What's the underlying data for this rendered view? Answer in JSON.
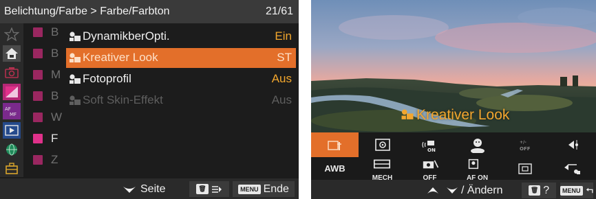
{
  "menu": {
    "header": {
      "title": "Belichtung/Farbe > Farbe/Farbton",
      "page": "21/61"
    },
    "category_icons": [
      "star-icon",
      "camera-home-icon",
      "photo-icon",
      "exposure-color-icon",
      "af-mf-icon",
      "playback-icon",
      "network-icon",
      "toolbox-icon"
    ],
    "subtabs": [
      {
        "letter": "B"
      },
      {
        "letter": "B"
      },
      {
        "letter": "M"
      },
      {
        "letter": "B"
      },
      {
        "letter": "W"
      },
      {
        "letter": "F"
      },
      {
        "letter": "Z"
      }
    ],
    "items": [
      {
        "label": "DynamikberOpti.",
        "value": "Ein"
      },
      {
        "label": "Kreativer Look",
        "value": "ST"
      },
      {
        "label": "Fotoprofil",
        "value": "Aus"
      },
      {
        "label": "Soft Skin-Effekt",
        "value": "Aus"
      }
    ],
    "footer": {
      "page_label": "Seite",
      "delete_key": "🗑",
      "menu_key": "MENU",
      "end_label": "Ende"
    }
  },
  "liveview": {
    "overlay_label": "Kreativer Look",
    "fn_row1": [
      "creative-look",
      "metering",
      "sound-on",
      "face-detect",
      "af-drive-off",
      "aperture-arrow"
    ],
    "fn_row2": [
      {
        "text": "AWB"
      },
      {
        "text": "MECH"
      },
      {
        "text": "OFF"
      },
      {
        "text": "AF ON"
      },
      {
        "text": ""
      },
      {
        "text": ""
      }
    ],
    "footer": {
      "change_label": "/ Ändern",
      "help_label": "?",
      "menu_key": "MENU"
    }
  },
  "colors": {
    "accent": "#e36f2a",
    "value": "#f3a72d",
    "subtab": "#9a2760"
  }
}
